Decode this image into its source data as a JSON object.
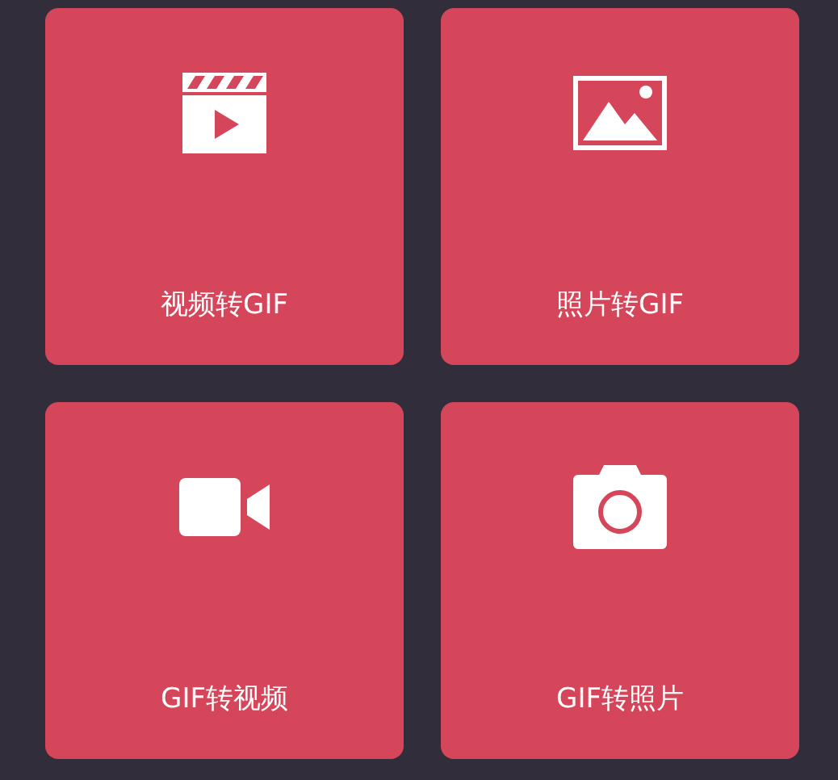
{
  "cards": [
    {
      "label": "视频转GIF",
      "kind": "clapper"
    },
    {
      "label": "照片转GIF",
      "kind": "image"
    },
    {
      "label": "GIF转视频",
      "kind": "video"
    },
    {
      "label": "GIF转照片",
      "kind": "camera"
    }
  ]
}
